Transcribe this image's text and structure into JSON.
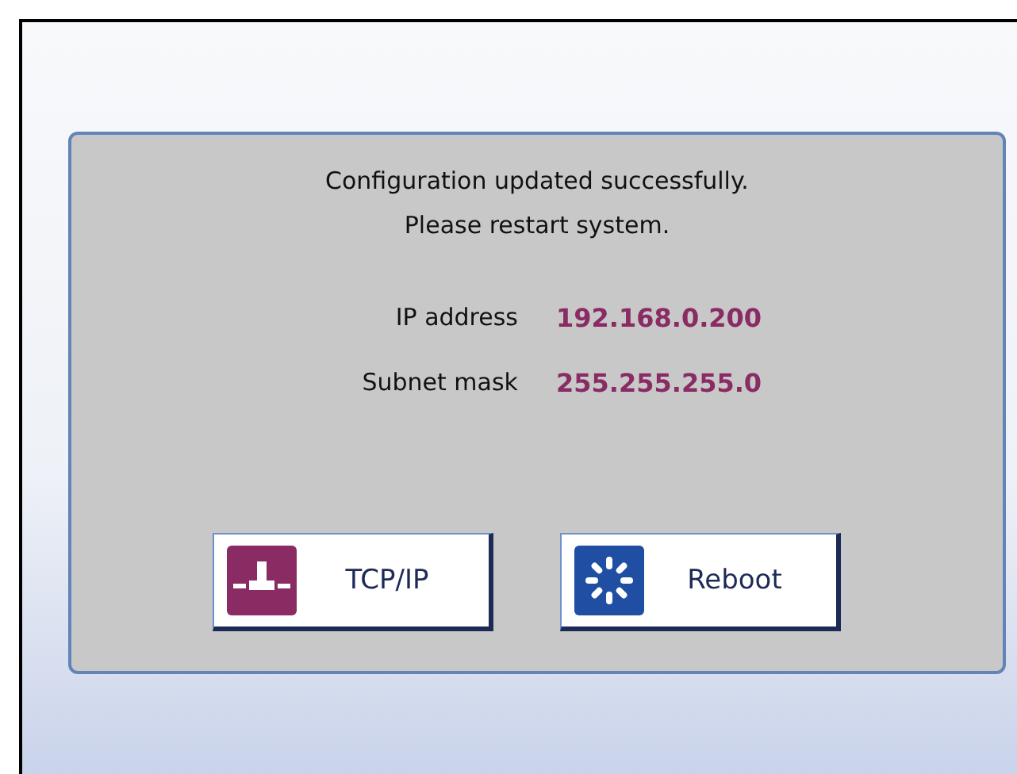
{
  "message": [
    "Configuration updated successfully.",
    "Please restart system."
  ],
  "fields": [
    {
      "label": "IP address",
      "value": "192.168.0.200"
    },
    {
      "label": "Subnet mask",
      "value": "255.255.255.0"
    }
  ],
  "buttons": [
    {
      "label": "TCP/IP",
      "kind": "network"
    },
    {
      "label": "Reboot",
      "kind": "reboot"
    }
  ]
}
